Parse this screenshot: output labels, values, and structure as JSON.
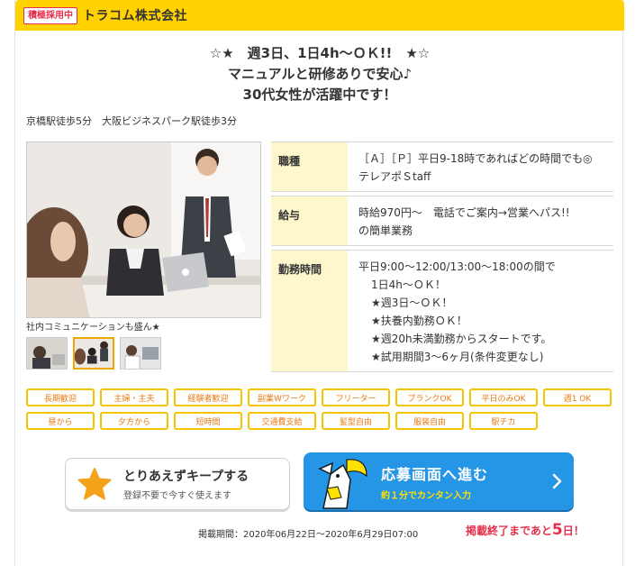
{
  "header": {
    "badge": "積極採用中",
    "company": "トラコム株式会社",
    "accent_color": "#ffd200"
  },
  "catch_copy": [
    "☆★　週3日、1日4h～ＯＫ!!　★☆",
    "マニュアルと研修ありで安心♪",
    "30代女性が活躍中です！"
  ],
  "access": "京橋駅徒歩5分　大阪ビジネスパーク駅徒歩3分",
  "photo": {
    "caption": "社内コミュニケーションも盛ん★",
    "thumbnail_count": 3,
    "selected_thumbnail": 2
  },
  "info": [
    {
      "label": "職種",
      "lines": [
        "［Ａ］［Ｐ］平日9-18時であればどの時間でも◎",
        "テレアポＳtaff"
      ]
    },
    {
      "label": "給与",
      "lines": [
        "時給970円～　電話でご案内→営業へパス!!",
        "の簡単業務"
      ]
    },
    {
      "label": "勤務時間",
      "lines": [
        "平日9:00～12:00/13:00～18:00の間で",
        "1日4h～ＯＫ！",
        "★週3日～ＯＫ！",
        "★扶養内勤務ＯＫ！",
        "★週20h未満勤務からスタートです。",
        "★試用期間3～6ヶ月(条件変更なし)"
      ]
    }
  ],
  "tags": [
    "長期歓迎",
    "主婦・主夫",
    "経験者歓迎",
    "副業Wワーク",
    "フリーター",
    "ブランクOK",
    "平日のみOK",
    "週1 OK",
    "昼から",
    "夕方から",
    "短時間",
    "交通費支給",
    "髪型自由",
    "服装自由",
    "駅チカ"
  ],
  "keep_button": {
    "title": "とりあえずキープする",
    "subtitle": "登録不要で今すぐ使えます"
  },
  "apply_button": {
    "title": "応募画面へ進む",
    "subtitle": "約１分でカンタン入力"
  },
  "footer": {
    "period": "掲載期間：2020年06月22日～2020年6月29日07:00",
    "remain_prefix": "掲載終了まであと",
    "remain_days": "5",
    "remain_suffix": "日！"
  }
}
